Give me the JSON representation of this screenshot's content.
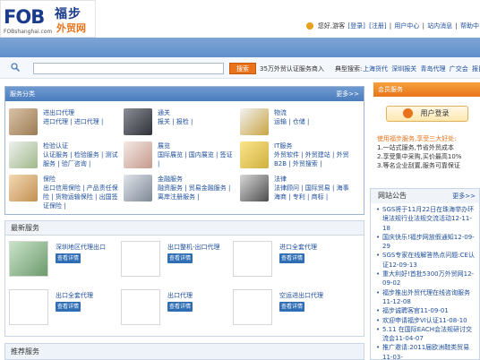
{
  "logo": {
    "brand": "FOB",
    "cn_main": "福步",
    "cn_sub": "外贸网",
    "domain": "FOBshanghai.com"
  },
  "topnav": {
    "greeting": "您好,游客",
    "login": "[登录]",
    "register": "[注册]",
    "user_center": "用户中心",
    "site_msg": "站内消息",
    "help": "帮助中"
  },
  "search": {
    "value": "",
    "button": "搜索",
    "count_text": "35万外贸认证服务商入",
    "tags_label": "典型搜索:",
    "tags": [
      "上海货代",
      "深圳报关",
      "青岛代理",
      "广交会",
      "报目"
    ]
  },
  "services": {
    "title": "服务分类",
    "more": "更多>>",
    "categories": [
      {
        "title": "进出口代理",
        "links": "进口代理 | 进口代理 |"
      },
      {
        "title": "通关",
        "links": "报关 | 报检 |"
      },
      {
        "title": "物流",
        "links": "运输 | 仓储 |"
      },
      {
        "title": "检验认证",
        "links": "认证服务 | 检验服务 | 测试服务 | 验厂咨询 |"
      },
      {
        "title": "展览",
        "links": "国际展览 | 国内展览 | 签证 |"
      },
      {
        "title": "IT服务",
        "links": "外贸软件 | 外贸建站 | 外贸B2B | 外贸搜索 |"
      },
      {
        "title": "保险",
        "links": "出口信用保险 | 产品责任保险 | 货物运输保险 | 出国签证保险 |"
      },
      {
        "title": "金融服务",
        "links": "融资服务 | 贸易金融服务 | 离岸注册服务 |"
      },
      {
        "title": "法律",
        "links": "法律顾问 | 国际贸易 | 海事海商 | 专利 | 商标 |"
      }
    ]
  },
  "latest": {
    "title": "最新服务",
    "view_label": "查看详情",
    "items": [
      {
        "title": "深圳地区代理出口"
      },
      {
        "title": "出口整机-出口代理"
      },
      {
        "title": "进口全套代理"
      },
      {
        "title": "出口全套代理"
      },
      {
        "title": "出口代理"
      },
      {
        "title": "空运进出口代理"
      }
    ]
  },
  "recommend": {
    "title": "推荐服务"
  },
  "member": {
    "title": "会员服务",
    "login_button": "用户登录",
    "intro_hl": "使用福步服务,",
    "intro_rest": "享受三大好处:",
    "benefits": [
      "1.一站式服务,节省外贸成本",
      "2.享受集中采购,买价最高10%",
      "3.等名企业刮置,服务可靠保证"
    ]
  },
  "notice": {
    "title": "网站公告",
    "more": "更多>>",
    "items": [
      "SGS将于11月22日在珠海举办环境法规行业法规交流活动12-11-18",
      "国庆快乐!福步网放假通知12-09-29",
      "SGS专家在线解答热点问题:CE认证12-09-13",
      "重大利好!首批5300万外贸网12-09-02",
      "福步推出外贸代理在线咨询服务11-12-08",
      "福步诚聘客官11-09-01",
      "欢迎申请福步VI认证11-08-10",
      "5.11 在国际EACH会法规研讨交流会11-04-07",
      "推广邀请:2011届欧洲鞋类贸易11-03-"
    ]
  },
  "colors": {
    "accent": "#4a7cbd",
    "orange": "#e8731a"
  }
}
